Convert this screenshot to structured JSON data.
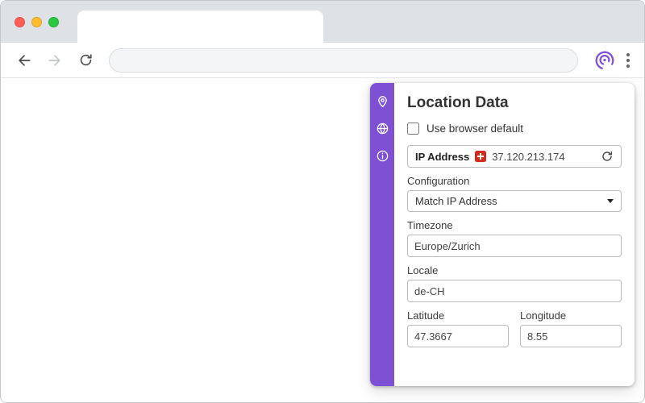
{
  "browser": {
    "tab_title": "",
    "address_value": ""
  },
  "panel": {
    "title": "Location Data",
    "checkbox_label": "Use browser default",
    "ip": {
      "label": "IP Address",
      "value": "37.120.213.174",
      "flag_country": "CH"
    },
    "configuration": {
      "label": "Configuration",
      "value": "Match IP Address"
    },
    "timezone": {
      "label": "Timezone",
      "value": "Europe/Zurich"
    },
    "locale": {
      "label": "Locale",
      "value": "de-CH"
    },
    "latitude": {
      "label": "Latitude",
      "value": "47.3667"
    },
    "longitude": {
      "label": "Longitude",
      "value": "8.55"
    }
  },
  "icons": {
    "back": "arrow-left",
    "forward": "arrow-right",
    "reload": "reload-circular-arrow",
    "extension": "purple-rings-logo",
    "menu": "vertical-kebab",
    "sidebar_location": "map-pin",
    "sidebar_globe": "globe",
    "sidebar_info": "info-circle",
    "ip_flag": "switzerland-flag",
    "ip_refresh": "refresh-arrow",
    "dropdown_caret": "caret-down"
  },
  "colors": {
    "accent_purple": "#7e50d4",
    "flag_red": "#d52b1e",
    "traffic_red": "#ff5f57",
    "traffic_yellow": "#febc2e",
    "traffic_green": "#28c840"
  }
}
